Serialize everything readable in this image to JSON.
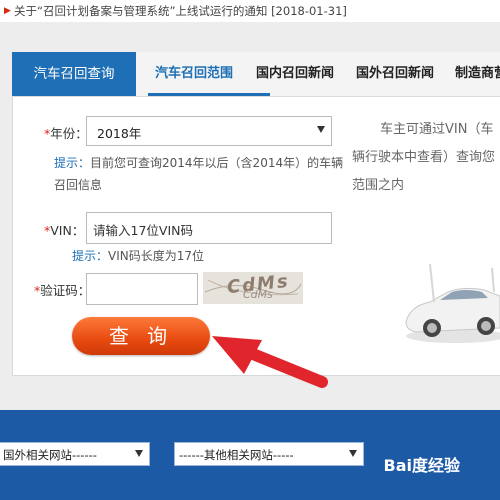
{
  "notice": {
    "text": "关于“召回计划备案与管理系统”上线试运行的通知 [2018-01-31]"
  },
  "tabs": [
    {
      "label": "汽车召回查询"
    },
    {
      "label": "汽车召回范围"
    },
    {
      "label": "国内召回新闻"
    },
    {
      "label": "国外召回新闻"
    },
    {
      "label": "制造商营"
    }
  ],
  "form": {
    "year": {
      "star": "*",
      "label": "年份：",
      "value": "2018年"
    },
    "year_hint": {
      "prefix": "提示：",
      "text_line1": "目前您可查询2014年以后（含2014年）的车辆",
      "text_line2": "召回信息"
    },
    "vin": {
      "star": "*",
      "label": "VIN：",
      "placeholder": "请输入17位VIN码"
    },
    "vin_hint": {
      "prefix": "提示：",
      "text": "VIN码长度为17位"
    },
    "captcha": {
      "star": "*",
      "label": "验证码：",
      "value": "",
      "image_text": "CdMs"
    },
    "submit_label": "查 询"
  },
  "info": {
    "line1": "车主可通过VIN（车",
    "line2": "辆行驶本中查看）查询您",
    "line3": "范围之内"
  },
  "footer": {
    "foreign_sites": "国外相关网站------",
    "other_sites": "------其他相关网站-----",
    "watermark": "Bai度经验"
  },
  "colors": {
    "tab_active_bg": "#1e6fb5",
    "submit": "#e84a10",
    "footer_bg": "#1d5aa5",
    "required": "#e02020",
    "arrow": "#e0262c"
  }
}
